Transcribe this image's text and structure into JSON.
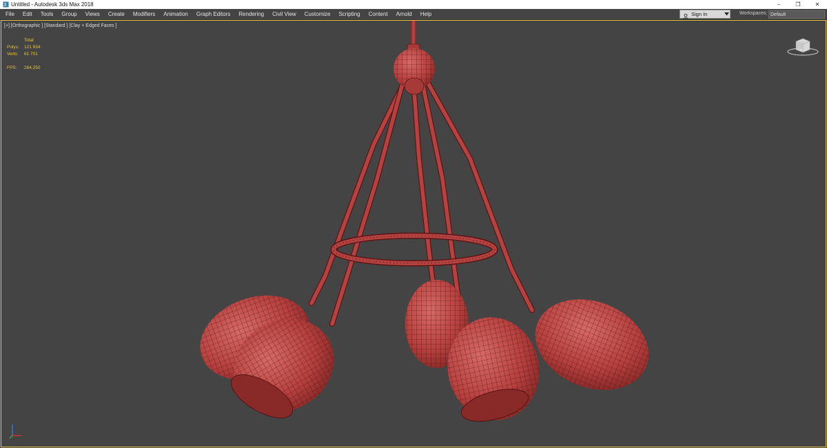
{
  "app": {
    "title": "Untitled - Autodesk 3ds Max 2018",
    "icon": "3ds-max-app-icon"
  },
  "window_controls": {
    "minimize": "–",
    "restore": "❐",
    "close": "✕"
  },
  "menu": {
    "items": [
      "File",
      "Edit",
      "Tools",
      "Group",
      "Views",
      "Create",
      "Modifiers",
      "Animation",
      "Graph Editors",
      "Rendering",
      "Civil View",
      "Customize",
      "Scripting",
      "Content",
      "Arnold",
      "Help"
    ]
  },
  "account": {
    "signin_label": "Sign In",
    "workspaces_label": "Workspaces:",
    "workspaces_value": "Default"
  },
  "viewport": {
    "label": "[+] [Orthographic ] [Standard ] [Clay + Edged Faces ]",
    "stats": {
      "total_label": "Total",
      "polys_label": "Polys:",
      "polys_value": "121 934",
      "verts_label": "Verts:",
      "verts_value": "61 701",
      "fps_label": "FPS:",
      "fps_value": "264,250"
    }
  },
  "colors": {
    "viewport_bg": "#444444",
    "model_fill": "#b5403e",
    "wire": "#4a0d0d",
    "active_border": "#e4c54a",
    "stats_text": "#e9c53e"
  }
}
